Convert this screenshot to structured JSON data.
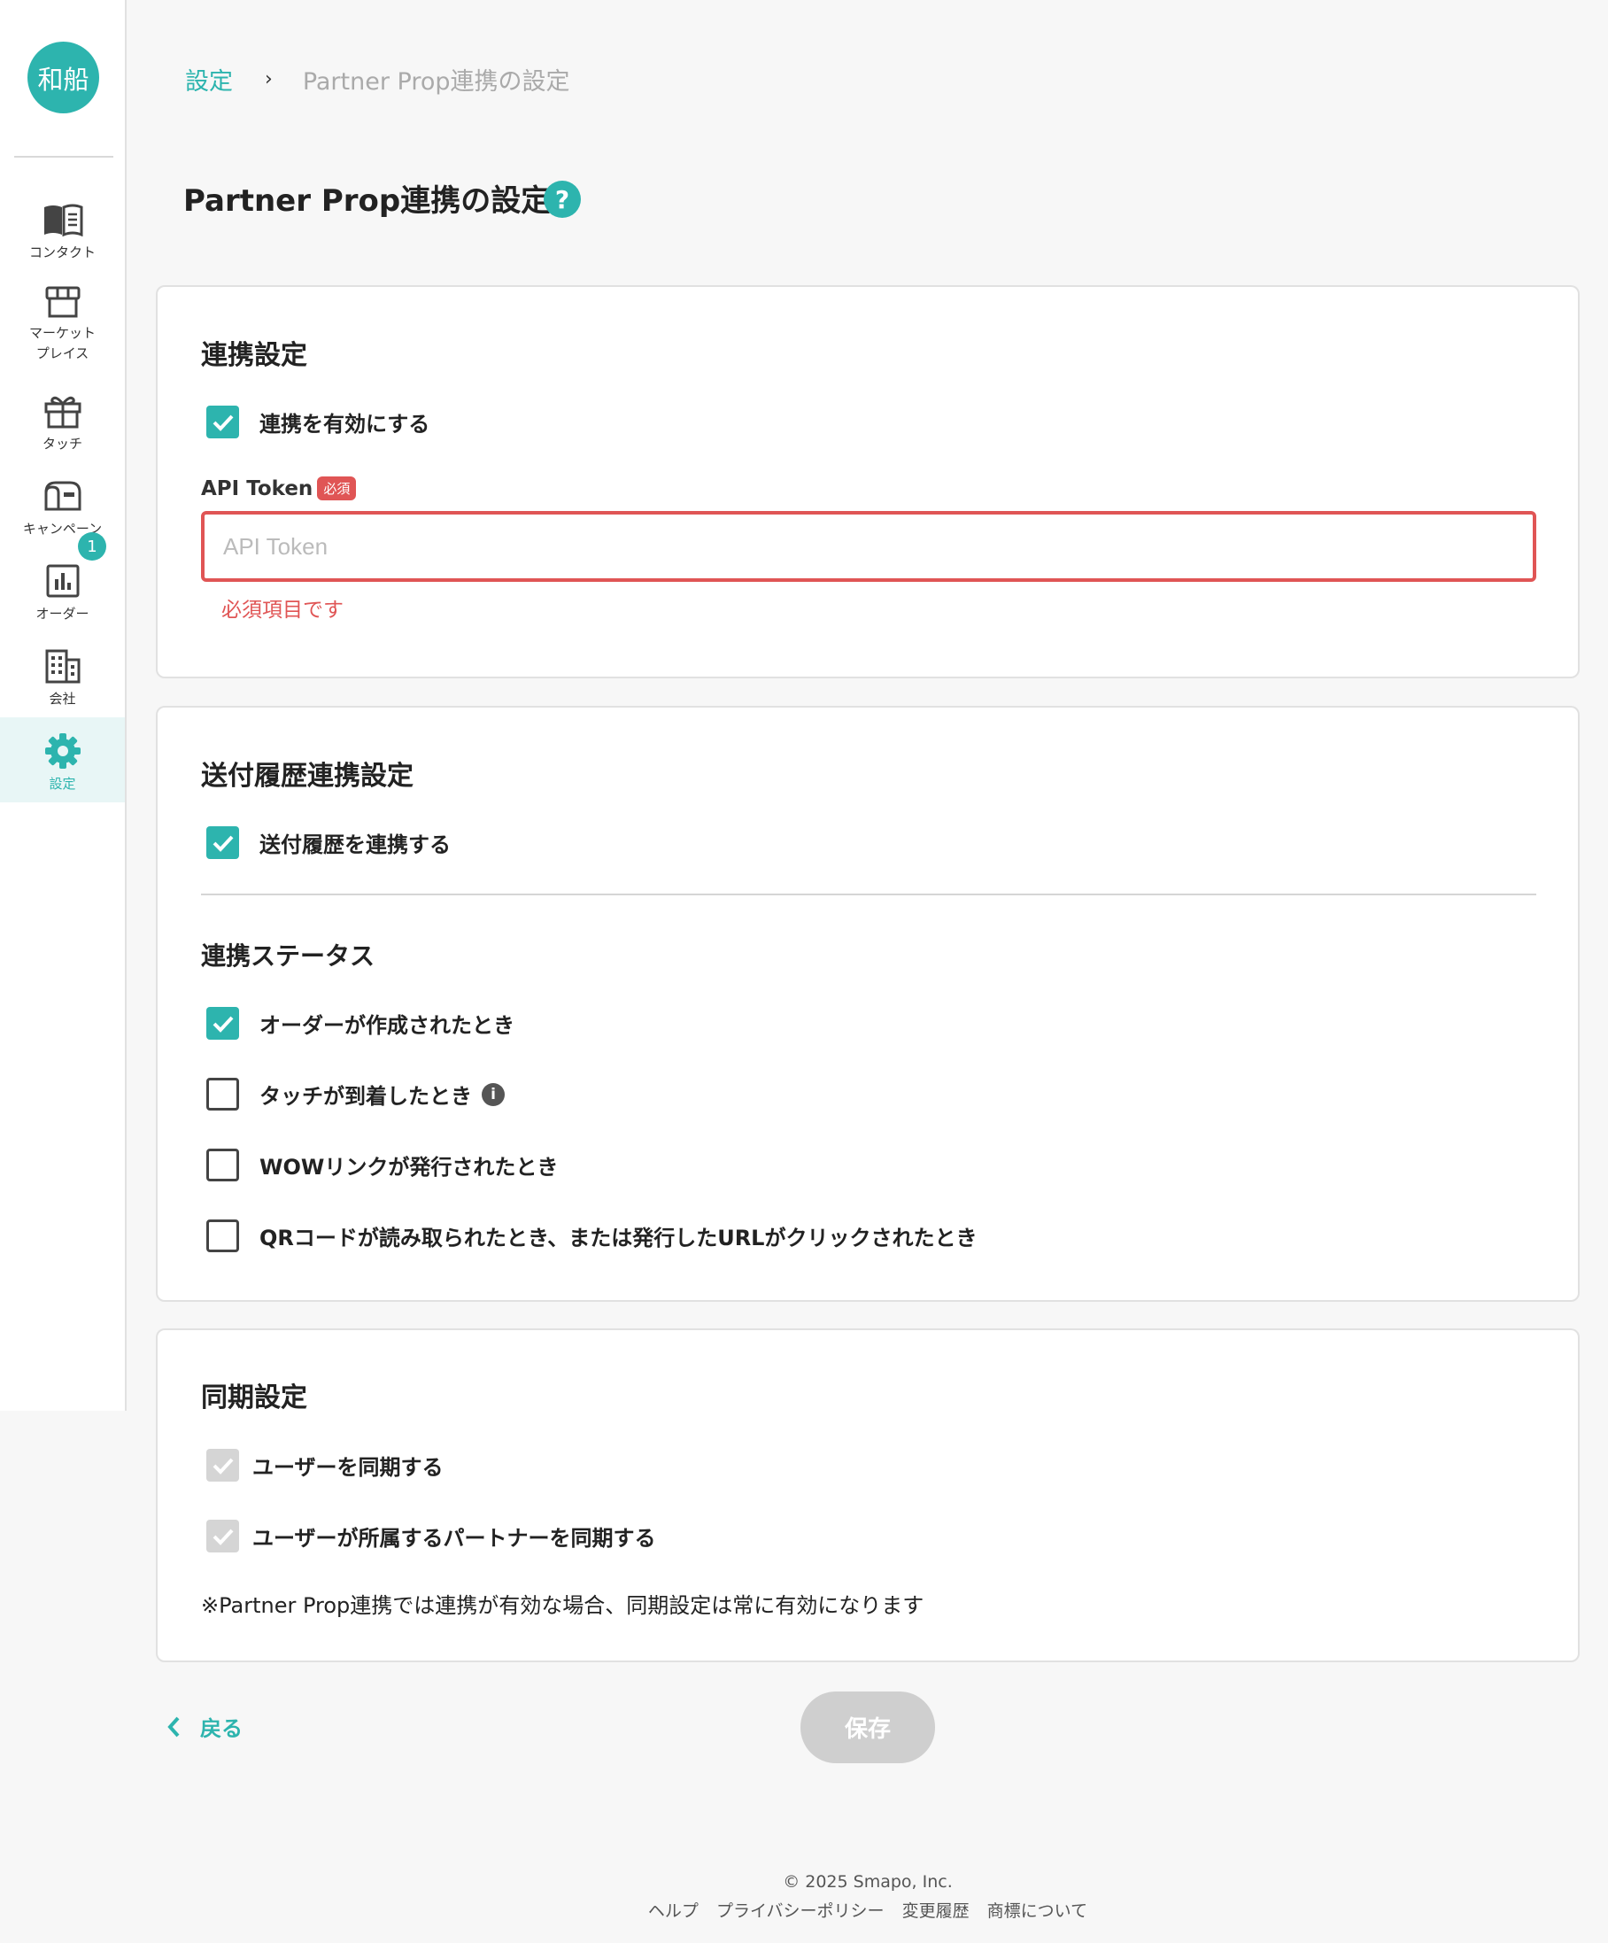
{
  "sidebar": {
    "logo_text": "和船",
    "items": [
      {
        "label": "コンタクト",
        "icon": "book-icon"
      },
      {
        "label": "マーケット\nプレイス",
        "icon": "store-icon"
      },
      {
        "label": "タッチ",
        "icon": "gift-icon"
      },
      {
        "label": "キャンペーン",
        "icon": "mailbox-icon"
      },
      {
        "label": "オーダー",
        "icon": "chart-icon"
      },
      {
        "label": "会社",
        "icon": "building-icon"
      },
      {
        "label": "設定",
        "icon": "gear-icon"
      }
    ],
    "badge_count": "1",
    "active": "設定"
  },
  "breadcrumb": {
    "parent": "設定",
    "separator": "›",
    "current": "Partner Prop連携の設定"
  },
  "page_title": "Partner Prop連携の設定",
  "help_icon": "?",
  "integration": {
    "title": "連携設定",
    "enable_label": "連携を有効にする",
    "enable_checked": true,
    "token_label": "API Token",
    "required_badge": "必須",
    "token_placeholder": "API Token",
    "token_value": "",
    "error_text": "必須項目です"
  },
  "history": {
    "title": "送付履歴連携設定",
    "history_label": "送付履歴を連携する",
    "history_checked": true,
    "status_title": "連携ステータス",
    "statuses": [
      {
        "label": "オーダーが作成されたとき",
        "checked": true
      },
      {
        "label": "タッチが到着したとき",
        "checked": false,
        "info": "i"
      },
      {
        "label": "WOWリンクが発行されたとき",
        "checked": false
      },
      {
        "label": "QRコードが読み取られたとき、または発行したURLがクリックされたとき",
        "checked": false
      }
    ]
  },
  "sync": {
    "title": "同期設定",
    "items": [
      {
        "label": "ユーザーを同期する",
        "checked": true,
        "disabled": true
      },
      {
        "label": "ユーザーが所属するパートナーを同期する",
        "checked": true,
        "disabled": true
      }
    ],
    "note": "※Partner Prop連携では連携が有効な場合、同期設定は常に有効になります"
  },
  "actions": {
    "back_label": "戻る",
    "save_label": "保存"
  },
  "footer": {
    "copyright": "© 2025 Smapo, Inc.",
    "links": [
      "ヘルプ",
      "プライバシーポリシー",
      "変更履歴",
      "商標について"
    ]
  },
  "colors": {
    "accent": "#2db4ae",
    "error": "#e05555",
    "disabled": "#cfcfcf"
  }
}
